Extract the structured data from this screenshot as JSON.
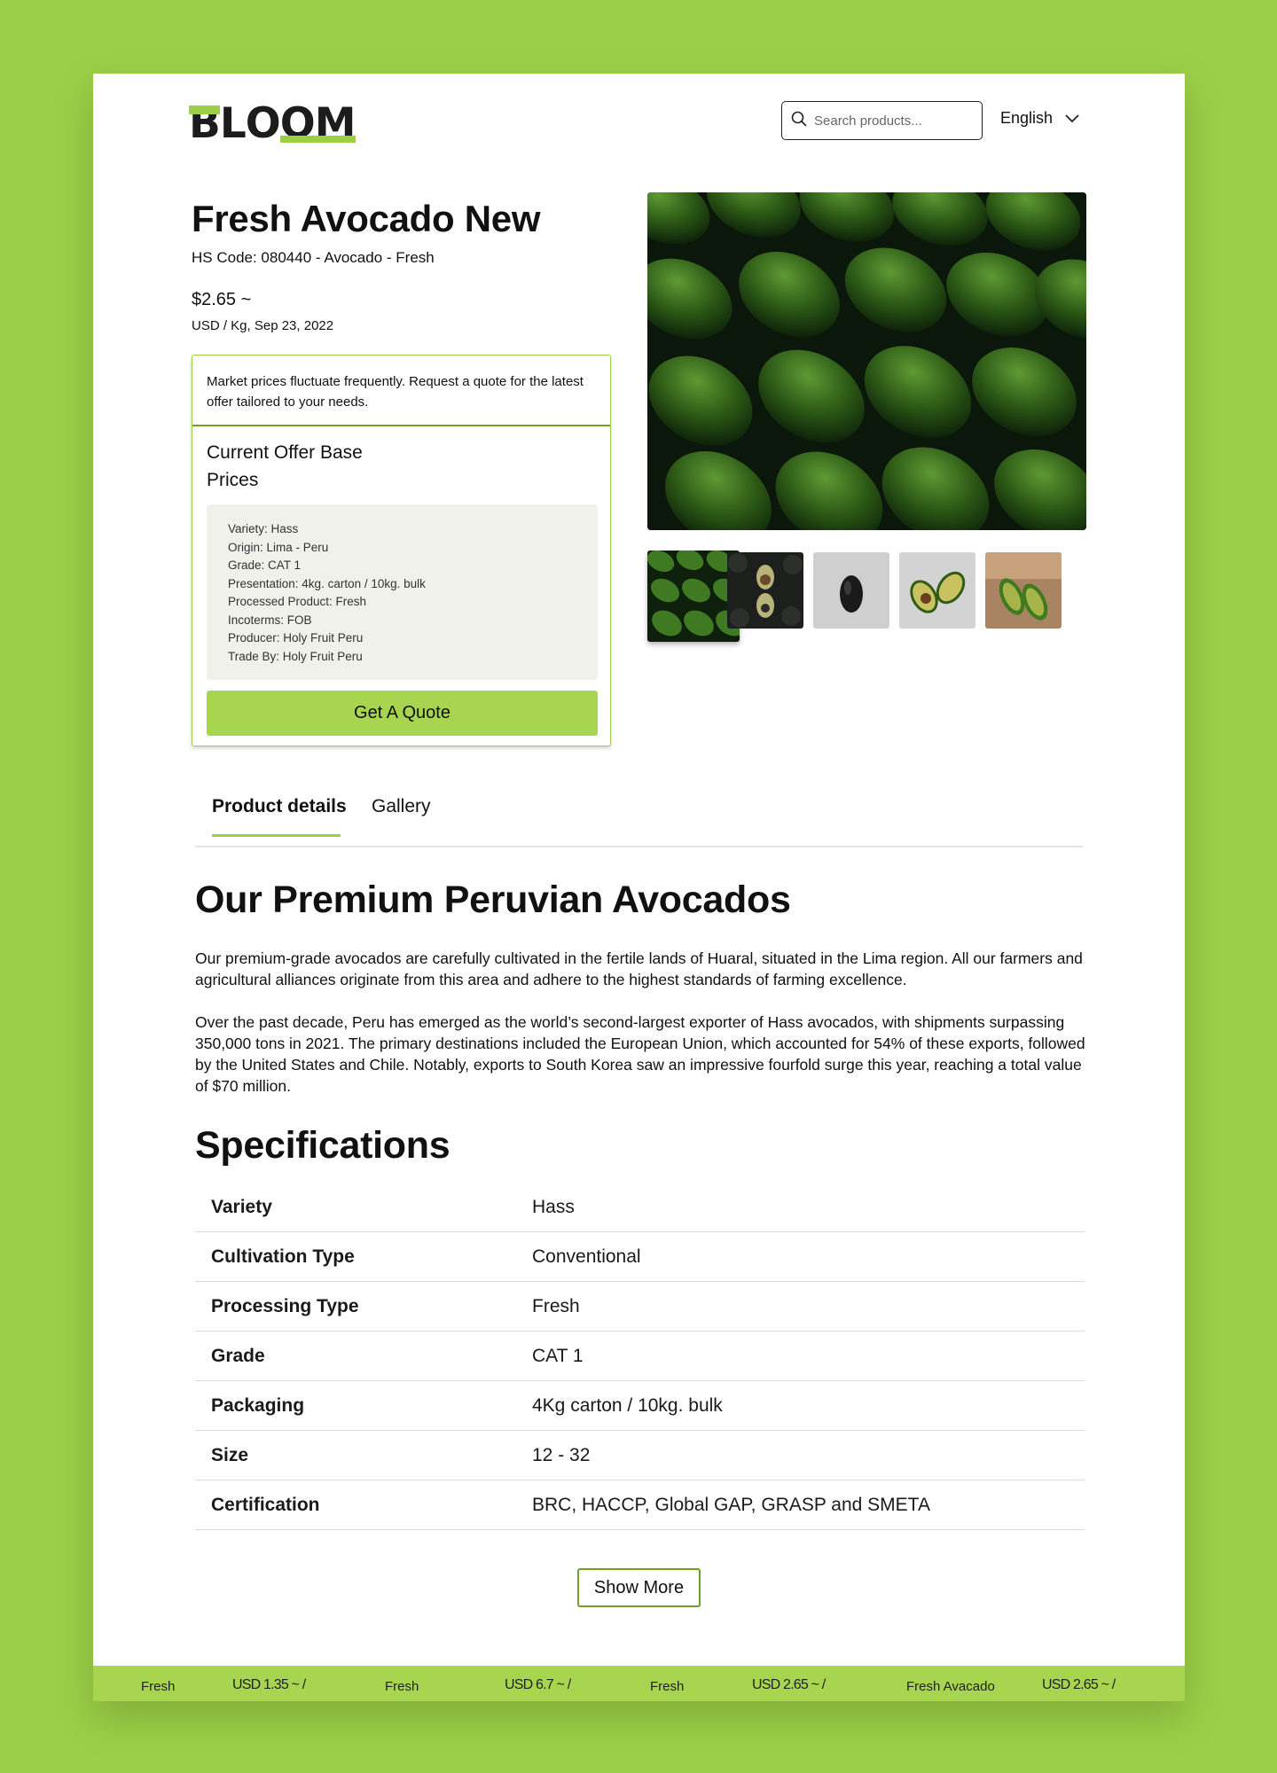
{
  "brand": {
    "name": "BLOOM"
  },
  "header": {
    "search_placeholder": "Search products...",
    "language": "English"
  },
  "product": {
    "title": "Fresh Avocado New",
    "hs_code": "HS Code: 080440 - Avocado - Fresh",
    "price": "$2.65 ~",
    "unit_date": "USD / Kg, Sep 23, 2022"
  },
  "offer": {
    "notice": "Market prices fluctuate frequently. Request a quote for the latest offer tailored to your needs.",
    "title": "Current Offer Base Prices",
    "details": [
      "Variety: Hass",
      "Origin: Lima - Peru",
      "Grade: CAT 1",
      "Presentation: 4kg. carton / 10kg. bulk",
      "Processed Product: Fresh",
      "Incoterms: FOB",
      "Producer: Holy Fruit Peru",
      "Trade By: Holy Fruit Peru"
    ],
    "cta": "Get A Quote"
  },
  "tabs": [
    "Product details",
    "Gallery"
  ],
  "about": {
    "title": "Our Premium Peruvian Avocados",
    "p1": "Our premium-grade avocados are carefully cultivated in the fertile lands of Huaral, situated in the Lima region. All our farmers and agricultural alliances originate from this area and adhere to the highest standards of farming excellence.",
    "p2": "Over the past decade, Peru has emerged as the world’s second-largest exporter of Hass avocados, with shipments surpassing 350,000 tons in 2021. The primary destinations included the European Union, which accounted for 54% of these exports, followed by the United States and Chile. Notably, exports to South Korea saw an impressive fourfold surge this year, reaching a total value of $70 million."
  },
  "specs": {
    "title": "Specifications",
    "rows": [
      {
        "key": "Variety",
        "value": "Hass"
      },
      {
        "key": "Cultivation Type",
        "value": "Conventional"
      },
      {
        "key": "Processing Type",
        "value": "Fresh"
      },
      {
        "key": "Grade",
        "value": "CAT 1"
      },
      {
        "key": "Packaging",
        "value": "4Kg carton / 10kg. bulk"
      },
      {
        "key": "Size",
        "value": "12 - 32"
      },
      {
        "key": "Certification",
        "value": "BRC, HACCP, Global GAP, GRASP and SMETA"
      }
    ],
    "show_more": "Show More"
  },
  "ticker": [
    {
      "name": "Fresh",
      "price": "USD 1.35 ~ /"
    },
    {
      "name": "Fresh",
      "price": "USD 6.7 ~ /"
    },
    {
      "name": "Fresh",
      "price": "USD 2.65 ~ /"
    },
    {
      "name": "Fresh Avacado",
      "price": "USD 2.65 ~ /"
    }
  ],
  "colors": {
    "accent": "#9ccf48",
    "button": "#a8d54f",
    "border_green": "#6fa21f"
  }
}
